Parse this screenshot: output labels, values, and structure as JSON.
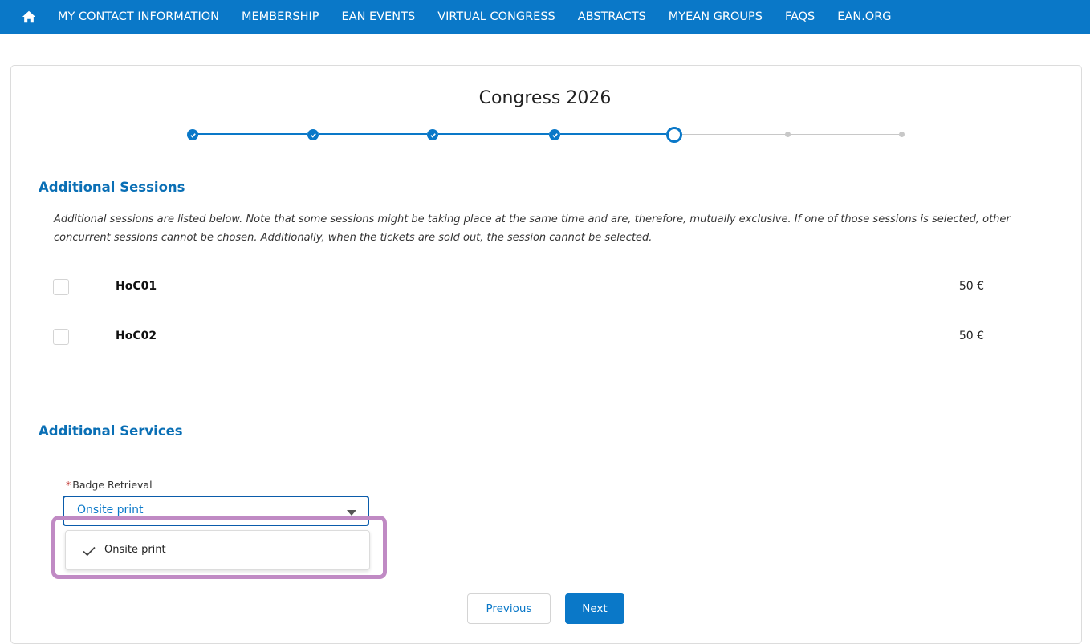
{
  "nav": {
    "home_icon": "home-icon",
    "items": [
      "MY CONTACT INFORMATION",
      "MEMBERSHIP",
      "EAN EVENTS",
      "VIRTUAL CONGRESS",
      "ABSTRACTS",
      "MYEAN GROUPS",
      "FAQS",
      "EAN.ORG"
    ]
  },
  "page": {
    "title": "Congress 2026"
  },
  "stepper": {
    "steps_total": 7,
    "completed": 4,
    "current": 5
  },
  "sessions": {
    "title": "Additional Sessions",
    "description": "Additional sessions are listed below. Note that some sessions might be taking place at the same time and are, therefore, mutually exclusive. If one of those sessions is selected, other concurrent sessions cannot be chosen. Additionally, when the tickets are sold out, the session cannot be selected.",
    "items": [
      {
        "name": "HoC01",
        "price": "50  €",
        "checked": false
      },
      {
        "name": "HoC02",
        "price": "50  €",
        "checked": false
      }
    ]
  },
  "services": {
    "title": "Additional Services",
    "badge_label": "Badge Retrieval",
    "required_mark": "*",
    "badge_value": "Onsite print",
    "options": [
      {
        "label": "Onsite print",
        "selected": true
      }
    ]
  },
  "buttons": {
    "previous": "Previous",
    "next": "Next"
  },
  "colors": {
    "primary": "#0a78c8",
    "highlight": "#c08ac4",
    "required": "#c23934"
  }
}
